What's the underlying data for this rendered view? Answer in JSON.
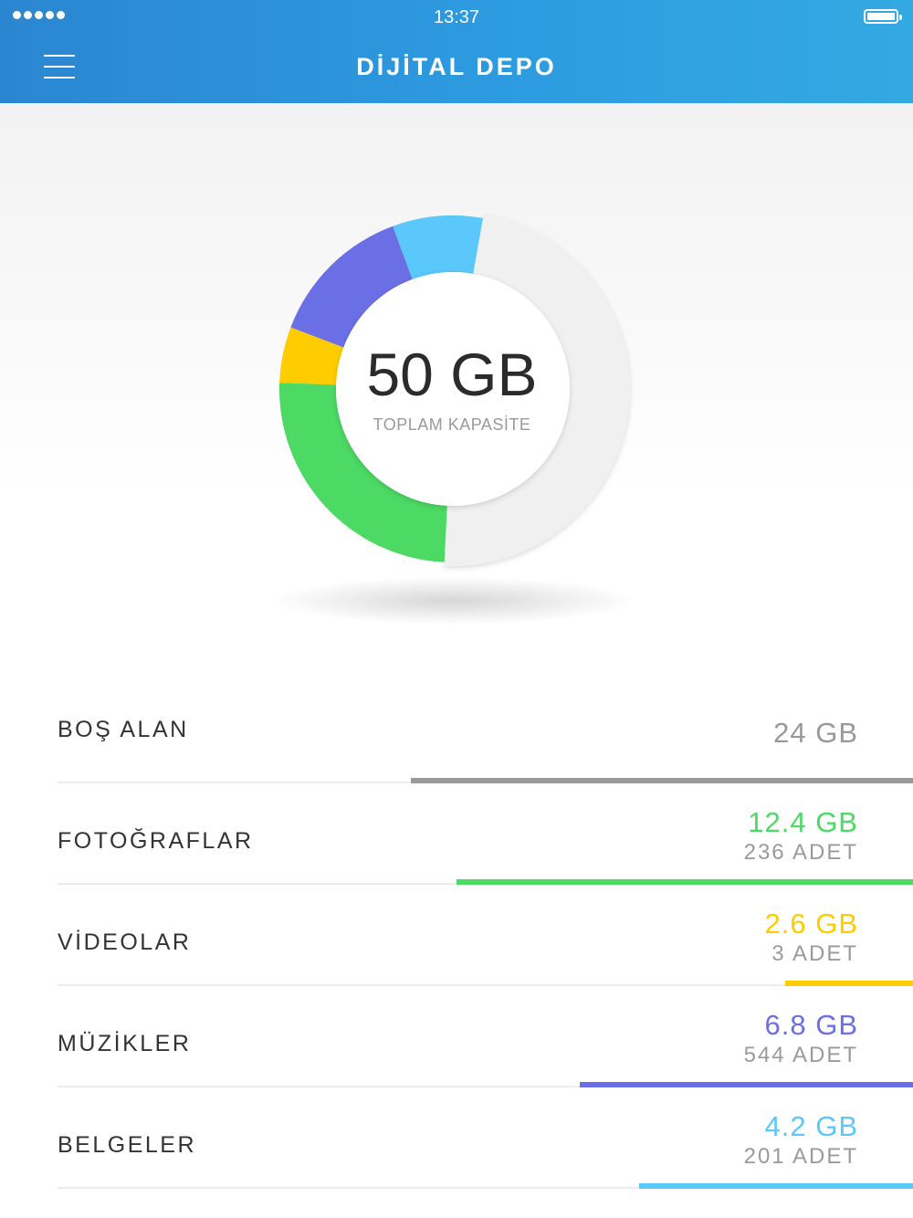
{
  "status_bar": {
    "time": "13:37"
  },
  "header": {
    "title": "DİJİTAL DEPO"
  },
  "storage": {
    "total": "50 GB",
    "total_label": "TOPLAM KAPASİTE",
    "items": [
      {
        "key": "bos-alan",
        "label": "BOŞ ALAN",
        "size": "24 GB",
        "count": "",
        "color": "#999999",
        "fraction": 0.55
      },
      {
        "key": "fotograflar",
        "label": "FOTOĞRAFLAR",
        "size": "12.4 GB",
        "count": "236 ADET",
        "color": "#4cd964",
        "fraction": 0.5
      },
      {
        "key": "videolar",
        "label": "VİDEOLAR",
        "size": "2.6 GB",
        "count": "3 ADET",
        "color": "#ffcc00",
        "fraction": 0.14
      },
      {
        "key": "muzikler",
        "label": "MÜZİKLER",
        "size": "6.8 GB",
        "count": "544 ADET",
        "color": "#6a6fe5",
        "fraction": 0.365
      },
      {
        "key": "belgeler",
        "label": "BELGELER",
        "size": "4.2 GB",
        "count": "201 ADET",
        "color": "#5ac8fa",
        "fraction": 0.3
      }
    ]
  },
  "colors": {
    "header": "#2d9be0",
    "free_segment": "#f0f0f0"
  }
}
